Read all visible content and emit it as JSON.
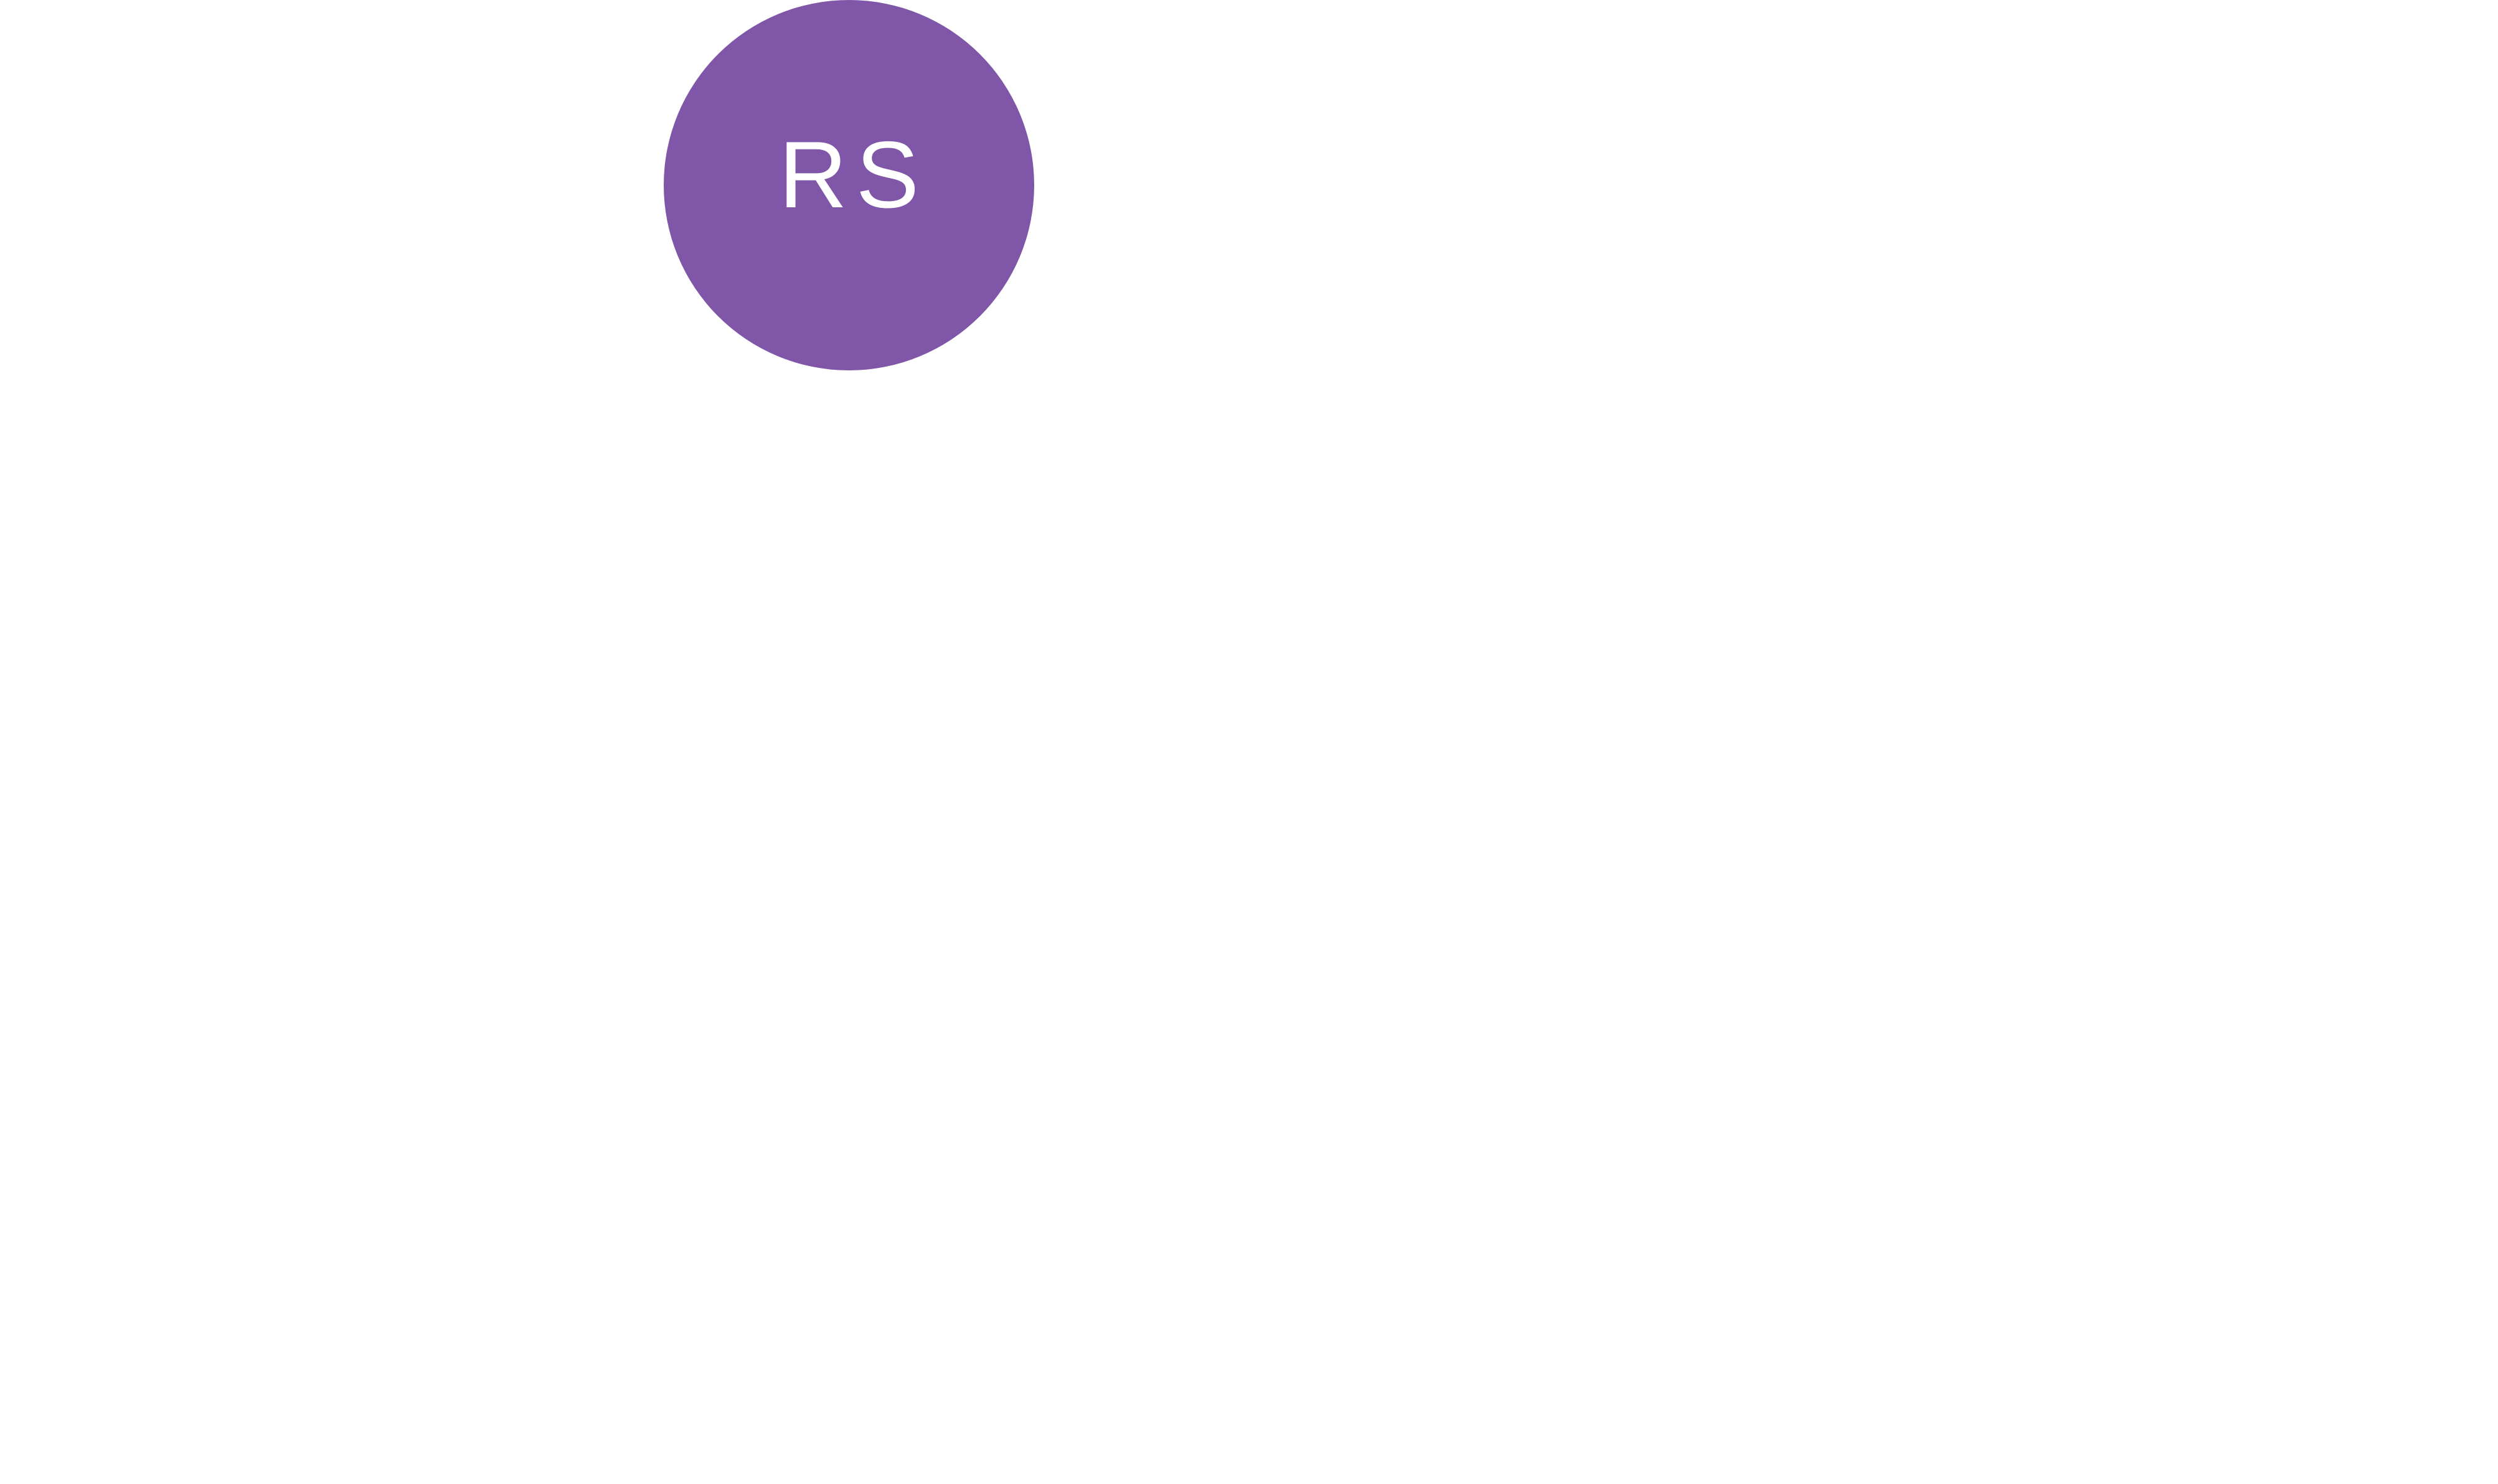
{
  "avatar": {
    "initials": "RS",
    "background_color": "#7f56a8",
    "text_color": "#ffffff"
  }
}
